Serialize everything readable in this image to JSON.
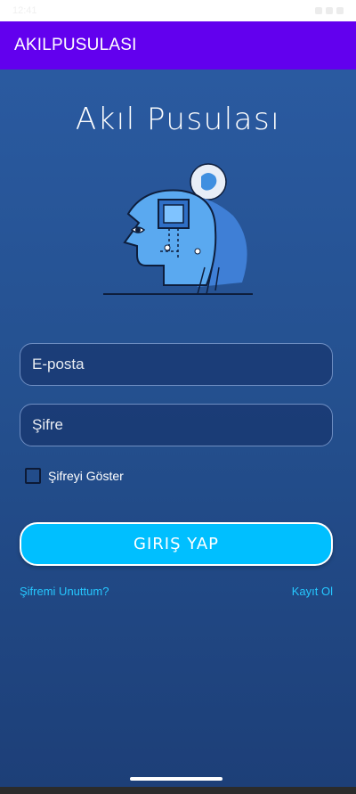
{
  "status_bar": {
    "time": "12:41",
    "icons": [
      "signal-icon",
      "wifi-icon",
      "battery-icon"
    ]
  },
  "app_bar": {
    "title": "AKILPUSULASI"
  },
  "brand": {
    "title": "Akıl Pusulası"
  },
  "form": {
    "email_placeholder": "E-posta",
    "password_placeholder": "Şifre",
    "show_password_label": "Şifreyi Göster",
    "show_password_checked": false,
    "login_label": "GIRIŞ YAP"
  },
  "links": {
    "forgot": "Şifremi Unuttum?",
    "register": "Kayıt Ol"
  },
  "colors": {
    "app_bar": "#6200ee",
    "background_top": "#2a5aa0",
    "background_bottom": "#1d3f78",
    "button": "#00bfff",
    "link": "#25c7ff"
  }
}
